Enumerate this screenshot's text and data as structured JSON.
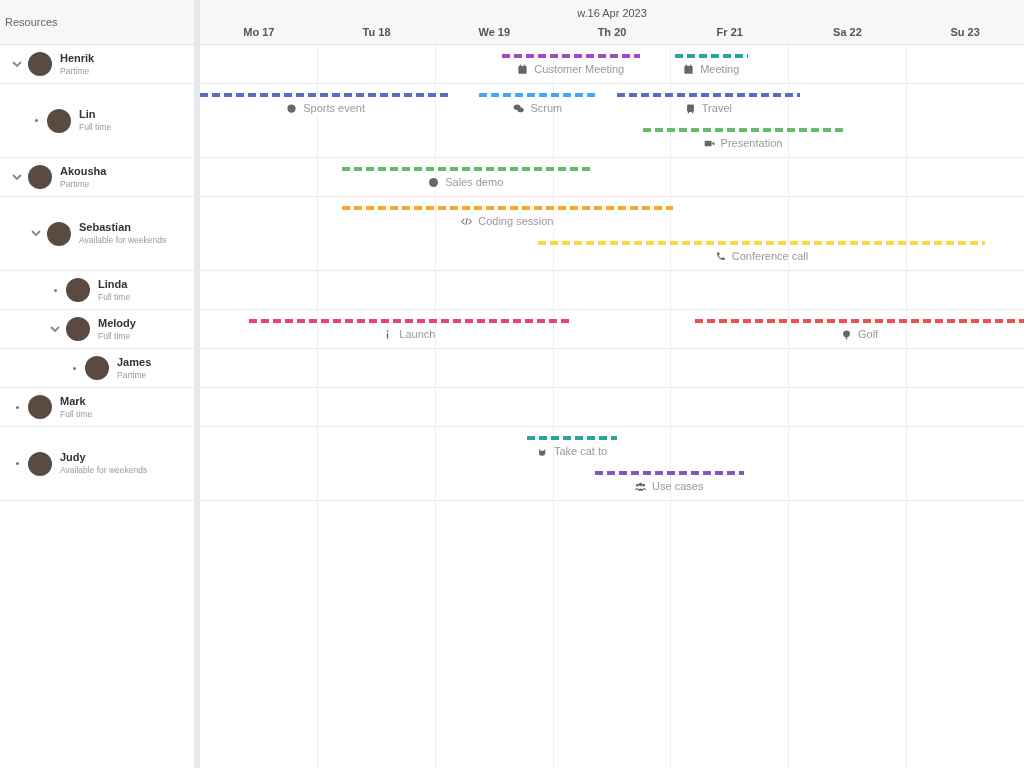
{
  "sidebar_header": "Resources",
  "week_label": "w.16 Apr 2023",
  "days": [
    "Mo 17",
    "Tu 18",
    "We 19",
    "Th 20",
    "Fr 21",
    "Sa 22",
    "Su 23"
  ],
  "resources": [
    {
      "name": "Henrik",
      "subtitle": "Partime",
      "expanded": true,
      "events": [
        {
          "title": "Customer Meeting",
          "color": "#ab47bc"
        },
        {
          "title": "Meeting",
          "color": "#26a69a"
        }
      ],
      "children": [
        {
          "name": "Lin",
          "subtitle": "Full time",
          "events": [
            {
              "title": "Sports event",
              "color": "#5c6bc0"
            },
            {
              "title": "Scrum",
              "color": "#42a5f5"
            },
            {
              "title": "Travel",
              "color": "#5c6bc0"
            },
            {
              "title": "Presentation",
              "color": "#66bb6a"
            }
          ]
        }
      ]
    },
    {
      "name": "Akousha",
      "subtitle": "Partime",
      "expanded": true,
      "events": [
        {
          "title": "Sales demo",
          "color": "#66bb6a"
        }
      ],
      "children": [
        {
          "name": "Sebastian",
          "subtitle": "Available for weekends",
          "expanded": true,
          "events": [
            {
              "title": "Coding session",
              "color": "#ffa726"
            },
            {
              "title": "Conference call",
              "color": "#fdd835"
            }
          ],
          "children": [
            {
              "name": "Linda",
              "subtitle": "Full time"
            },
            {
              "name": "Melody",
              "subtitle": "Full time",
              "expanded": true,
              "events": [
                {
                  "title": "Launch",
                  "color": "#ec407a"
                },
                {
                  "title": "Golf",
                  "color": "#ef5350"
                }
              ],
              "children": [
                {
                  "name": "James",
                  "subtitle": "Partime"
                }
              ]
            }
          ]
        }
      ]
    },
    {
      "name": "Mark",
      "subtitle": "Full time"
    },
    {
      "name": "Judy",
      "subtitle": "Available for weekends",
      "events": [
        {
          "title": "Take cat to",
          "color": "#26a69a"
        },
        {
          "title": "Use cases",
          "color": "#7e57c2"
        }
      ]
    }
  ]
}
